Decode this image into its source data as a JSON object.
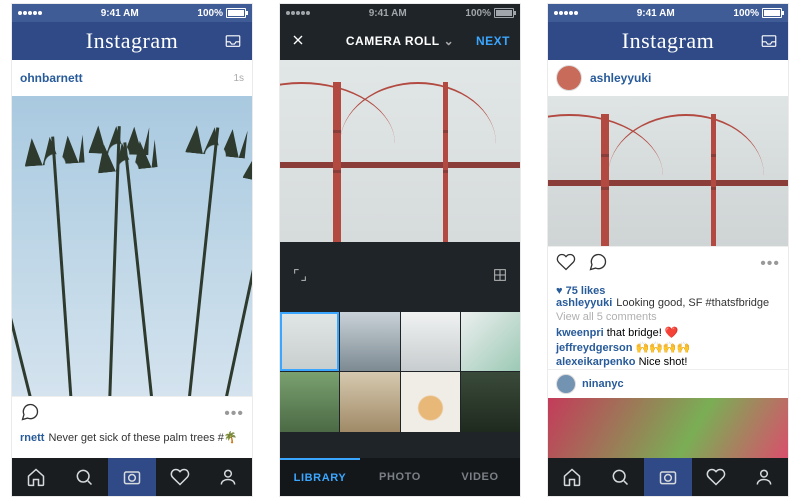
{
  "status": {
    "time": "9:41 AM",
    "battery": "100%",
    "carrier": "•••••"
  },
  "app": {
    "logo": "Instagram",
    "next": "NEXT"
  },
  "left": {
    "username": "ohnbarnett",
    "post_age": "1s",
    "caption_user": "rnett",
    "caption": "Never get sick of these palm trees #🌴"
  },
  "middle": {
    "title": "CAMERA ROLL",
    "tabs": [
      "LIBRARY",
      "PHOTO",
      "VIDEO"
    ],
    "active_tab": 0
  },
  "right": {
    "username": "ashleyyuki",
    "likes": "75 likes",
    "caption": "Looking good, SF #thatsfbridge",
    "view_all": "View all 5 comments",
    "comments": [
      {
        "user": "kweenpri",
        "text": "that bridge! ❤️"
      },
      {
        "user": "jeffreydgerson",
        "text": "🙌🙌🙌🙌"
      },
      {
        "user": "alexeikarpenko",
        "text": "Nice shot!"
      }
    ],
    "next_user": "ninanyc"
  }
}
